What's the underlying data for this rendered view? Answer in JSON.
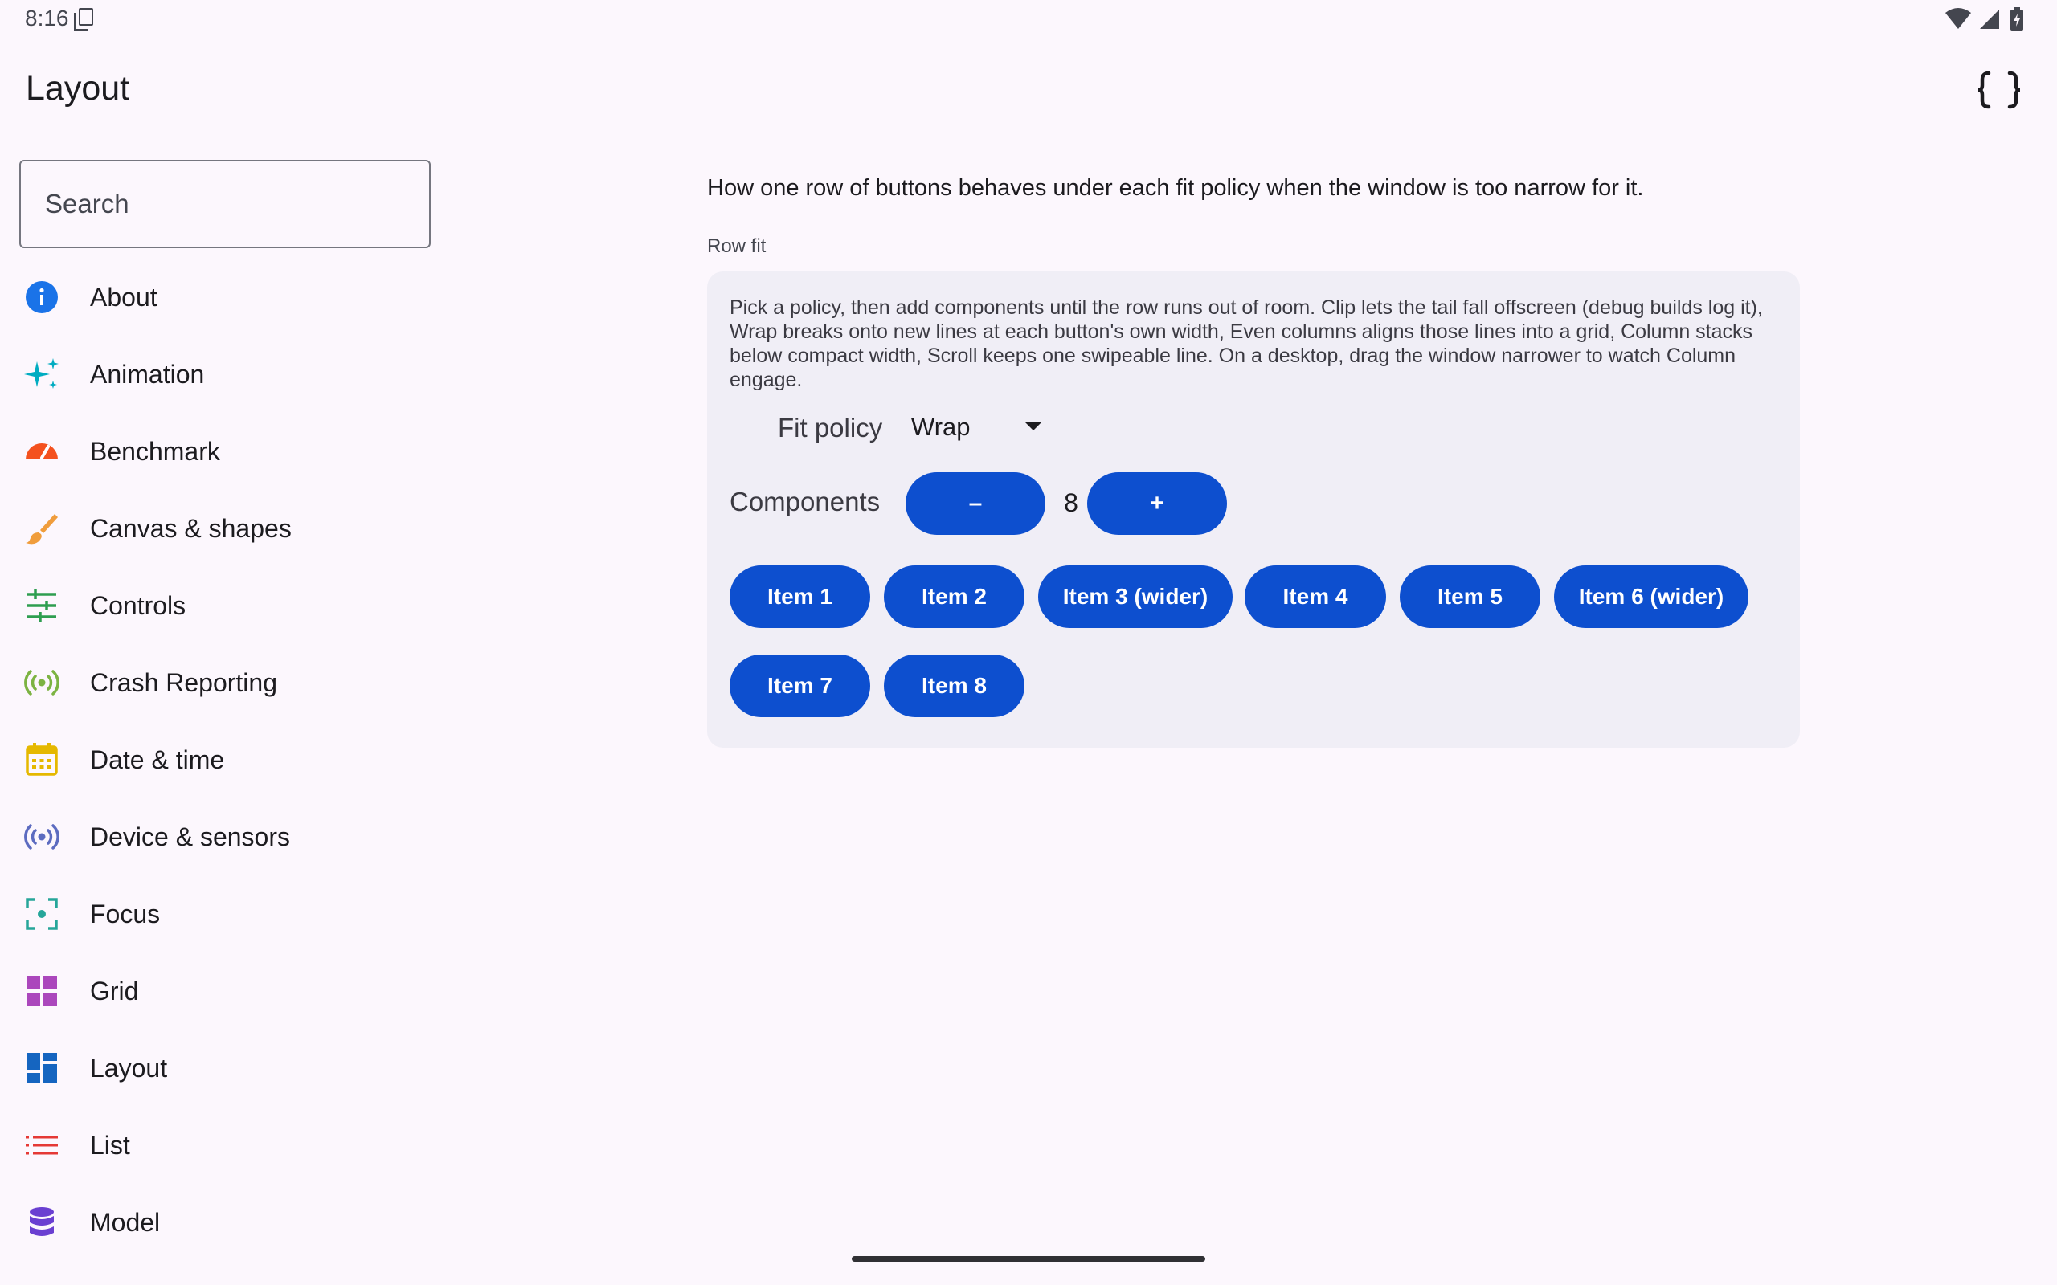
{
  "status_bar": {
    "time": "8:16"
  },
  "app": {
    "title": "Layout"
  },
  "search": {
    "placeholder": "Search"
  },
  "sidebar": {
    "items": [
      {
        "label": "About",
        "icon": "info-icon",
        "color": "#1a73e8"
      },
      {
        "label": "Animation",
        "icon": "sparkle-icon",
        "color": "#00acc1"
      },
      {
        "label": "Benchmark",
        "icon": "speedometer-icon",
        "color": "#f4511e"
      },
      {
        "label": "Canvas & shapes",
        "icon": "brush-icon",
        "color": "#f09d3c"
      },
      {
        "label": "Controls",
        "icon": "sliders-icon",
        "color": "#2e9e50"
      },
      {
        "label": "Crash Reporting",
        "icon": "broadcast-icon",
        "color": "#7cb342"
      },
      {
        "label": "Date & time",
        "icon": "calendar-icon",
        "color": "#e5b800"
      },
      {
        "label": "Device & sensors",
        "icon": "sensor-icon",
        "color": "#5c6bc0"
      },
      {
        "label": "Focus",
        "icon": "focus-icon",
        "color": "#26a69a"
      },
      {
        "label": "Grid",
        "icon": "grid-icon",
        "color": "#ab47bc"
      },
      {
        "label": "Layout",
        "icon": "layout-icon",
        "color": "#1565c0"
      },
      {
        "label": "List",
        "icon": "list-icon",
        "color": "#e53935"
      },
      {
        "label": "Model",
        "icon": "database-icon",
        "color": "#6a3fd1"
      }
    ]
  },
  "main": {
    "intro": "How one row of buttons behaves under each fit policy when the window is too narrow for it.",
    "section_label": "Row fit",
    "description": "Pick a policy, then add components until the row runs out of room. Clip lets the tail fall offscreen (debug builds log it), Wrap breaks onto new lines at each button's own width, Even columns aligns those lines into a grid, Column stacks below compact width, Scroll keeps one swipeable line. On a desktop, drag the window narrower to watch Column engage.",
    "fit_policy": {
      "label": "Fit policy",
      "value": "Wrap"
    },
    "components": {
      "label": "Components",
      "minus": "–",
      "plus": "+",
      "count": "8"
    },
    "items": [
      "Item 1",
      "Item 2",
      "Item 3 (wider)",
      "Item 4",
      "Item 5",
      "Item 6 (wider)",
      "Item 7",
      "Item 8"
    ]
  },
  "colors": {
    "accent": "#0d4fcf",
    "background": "#fcf7fd",
    "card": "#f0eef6"
  }
}
